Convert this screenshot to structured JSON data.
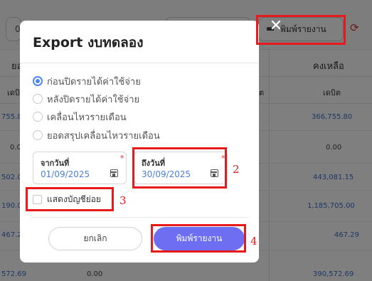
{
  "background": {
    "pill_left": "0",
    "print_button_label": "พิมพ์รายงาน",
    "header_top_left": "ยอ",
    "header_top_right": "คงเหลือ",
    "sub_left": "เดบิต",
    "sub_mid": "ต",
    "sub_right": "เดบิต",
    "rows": [
      {
        "left": "755.8",
        "mid": "",
        "right": "366,755.80"
      },
      {
        "left": "0.00",
        "mid": "",
        "right": "0.00"
      },
      {
        "left": "502.0",
        "mid": "",
        "right": "443,081.15"
      },
      {
        "left": "190.0",
        "mid": "",
        "right": "1,185,705.00"
      },
      {
        "left": "467.2",
        "mid": "",
        "right": "467.29"
      },
      {
        "left": "572.69",
        "mid": "0.00",
        "right": "390,572.69"
      }
    ]
  },
  "modal": {
    "title": "Export งบทดลอง",
    "radios": [
      {
        "label": "ก่อนปิดรายได้ค่าใช้จ่าย",
        "selected": true
      },
      {
        "label": "หลังปิดรายได้ค่าใช้จ่าย",
        "selected": false
      },
      {
        "label": "เคลื่อนไหวรายเดือน",
        "selected": false
      },
      {
        "label": "ยอดสรุปเคลื่อนไหวรายเดือน",
        "selected": false
      }
    ],
    "from_date": {
      "label": "จากวันที่",
      "value": "01/09/2025",
      "required_mark": "*"
    },
    "to_date": {
      "label": "ถึงวันที่",
      "value": "30/09/2025",
      "required_mark": "*"
    },
    "show_sub_accounts": {
      "label": "แสดงบัญชีย่อย",
      "checked": false
    },
    "cancel_label": "ยกเลิก",
    "print_label": "พิมพ์รายงาน",
    "close_glyph": "✕"
  },
  "annotations": {
    "labels": [
      "2",
      "3",
      "4"
    ],
    "color": "#e61a1a"
  },
  "colors": {
    "accent": "#6d6ef2",
    "radio_selected": "#4e86f0",
    "date_value": "#4a7fd9"
  }
}
